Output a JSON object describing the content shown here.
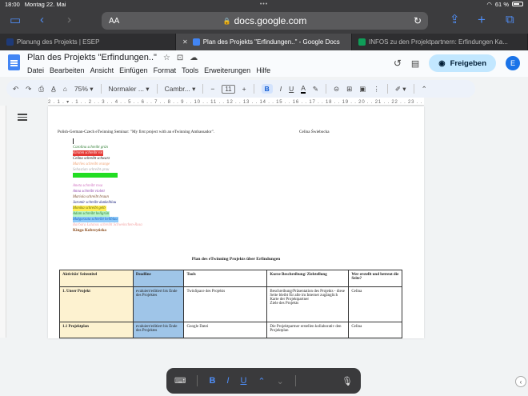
{
  "status": {
    "time": "18:00",
    "date": "Montag 22. Mai",
    "dots": "•••",
    "battery": "61 %"
  },
  "browser": {
    "aa": "AA",
    "url": "docs.google.com",
    "lock_icon": "lock-icon"
  },
  "tabs": [
    {
      "title": "Planung des Projekts | ESEP",
      "color": "#1e3a78",
      "active": false
    },
    {
      "title": "Plan des Projekts \"Erfindungen..\" - Google Docs",
      "color": "#4285f4",
      "active": true
    },
    {
      "title": "INFOS zu den Projektpartnern: Erfindungen Ka...",
      "color": "#0f9d58",
      "active": false
    }
  ],
  "doc": {
    "title": "Plan des Projekts \"Erfindungen..\"",
    "menus": [
      "Datei",
      "Bearbeiten",
      "Ansicht",
      "Einfügen",
      "Format",
      "Tools",
      "Erweiterungen",
      "Hilfe"
    ],
    "share_label": "Freigeben",
    "avatar_letter": "E"
  },
  "toolbar": {
    "zoom": "75%",
    "style": "Normaler ...",
    "font": "Cambr...",
    "font_size": "11",
    "minus": "−",
    "plus": "+"
  },
  "ruler": {
    "ticks": "2 . 1 . ▾ . 1 . . 2 . . 3 . . 4 . . 5 . . 6 . . 7 . . 8 . . 9 . . 10 . . 11 . . 12 . . 13 . . 14 . . 15 . . 16 . . 17 . . 18 . . 19 . . 20 . . 21 . . 22 . . 23 . . 24 . . 25 . . 26 . . 27 ."
  },
  "page": {
    "seminar": "Polish-German-Czech eTwinning Seminar: \"My first project with an eTwinning Ambassador\".",
    "author": "Celina Świebocka",
    "names": [
      {
        "text": "Carolina schreibt grün",
        "color": "#2e7d32",
        "bg": ""
      },
      {
        "text": "Kirsten schreibt rot",
        "color": "#ffffff",
        "bg": "#e53935"
      },
      {
        "text": "Celina schreibt schwarz",
        "color": "#111111",
        "bg": ""
      },
      {
        "text": "Marlies schreibt orange",
        "color": "#f0a070",
        "bg": ""
      },
      {
        "text": "Sebastian schreibt grau",
        "color": "#aaaaaa",
        "bg": ""
      },
      {
        "text": "",
        "color": "#22cc22",
        "bg": "#22dd22"
      },
      {
        "text": "",
        "color": "#fff",
        "bg": ""
      },
      {
        "text": "Aneta schreibt rosa",
        "color": "#d070c0",
        "bg": ""
      },
      {
        "text": "Anna schreibt  violett",
        "color": "#8e44ad",
        "bg": ""
      },
      {
        "text": "Mariola schreibt braun",
        "color": "#7a4a2a",
        "bg": ""
      },
      {
        "text": "Jaromir schreibt dunkelblau",
        "color": "#1a237e",
        "bg": ""
      },
      {
        "text": "Monika schreibt gelb",
        "color": "#6a6a00",
        "bg": "#ffee58"
      },
      {
        "text": "Adam  schreibt hellgrün",
        "color": "#2e7d32",
        "bg": "#b9f6ca"
      },
      {
        "text": "Małgorzata schreibt hellblau",
        "color": "#1565c0",
        "bg": "#90caf9"
      },
      {
        "text": "Barbara Łatanas schreibt Schweinchen-Rosa",
        "color": "#f4a4a4",
        "bg": ""
      }
    ],
    "kinga": "Kinga Kobrzyńska",
    "plan_title": "Plan des eTwinning Projekts  über Erfindungen",
    "table": {
      "headers": [
        "Aktivität/ Seitentitel",
        "Deadline",
        "Tools",
        "Kurze Beschreibung/ Zielstellung",
        "Wer erstellt und betreut die Seite?"
      ],
      "rows": [
        [
          "1. Unser Projekt",
          "evaluiert/editiert bis Ende des Projektes",
          "TwinSpace des Projekts",
          "Beschreibung/Präsentation des Projekts - diese Seite bleibt für alle im Internet zugänglich\nKarte der Projektpartner\nZiele des Projekts",
          "Celina"
        ],
        [
          "1.1 Projektplan",
          "evaluiert/editiert bis Ende des Projektes",
          "Google Datei",
          "Die Projektpartner erstellen kollaborativ den Projektplan",
          "Celina"
        ]
      ]
    }
  },
  "keyboard_bar": {
    "bold": "B",
    "italic": "I",
    "underline": "U",
    "up": "⌃",
    "down": "⌄"
  }
}
